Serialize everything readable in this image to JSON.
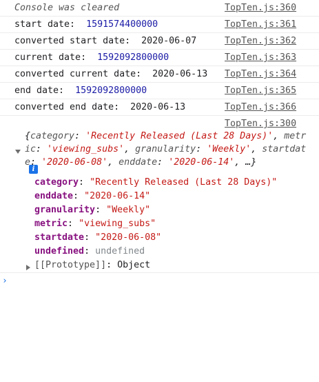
{
  "console": {
    "rows": [
      {
        "text": "Console was cleared",
        "source": "TopTen.js:360"
      },
      {
        "label": "start date:",
        "value": "1591574400000",
        "source": "TopTen.js:361"
      },
      {
        "label": "converted start date:",
        "value": "2020-06-07",
        "source": "TopTen.js:362"
      },
      {
        "label": "current date:",
        "value": "1592092800000",
        "source": "TopTen.js:363"
      },
      {
        "label": "converted current date:",
        "value": "2020-06-13",
        "source": "TopTen.js:364"
      },
      {
        "label": "end date:",
        "value": "1592092800000",
        "source": "TopTen.js:365"
      },
      {
        "label": "converted end date:",
        "value": "2020-06-13",
        "source": "TopTen.js:366"
      }
    ],
    "object_log": {
      "source": "TopTen.js:300",
      "preview": {
        "open": "{",
        "k1": "category",
        "v1": "'Recently Released (Last 28 Days)'",
        "k2": "metric",
        "v2": "'viewing_subs'",
        "k3": "granularity",
        "v3": "'Weekly'",
        "k4": "startdate",
        "v4": "'2020-06-08'",
        "k5": "enddate",
        "v5": "'2020-06-14'",
        "tail": "…}"
      },
      "info_glyph": "i",
      "properties": [
        {
          "key": "category",
          "value": "\"Recently Released (Last 28 Days)\""
        },
        {
          "key": "enddate",
          "value": "\"2020-06-14\""
        },
        {
          "key": "granularity",
          "value": "\"Weekly\""
        },
        {
          "key": "metric",
          "value": "\"viewing_subs\""
        },
        {
          "key": "startdate",
          "value": "\"2020-06-08\""
        },
        {
          "key": "undefined",
          "value": "undefined"
        }
      ],
      "prototype_key": "[[Prototype]]",
      "prototype_value": "Object"
    },
    "prompt_symbol": "›"
  }
}
